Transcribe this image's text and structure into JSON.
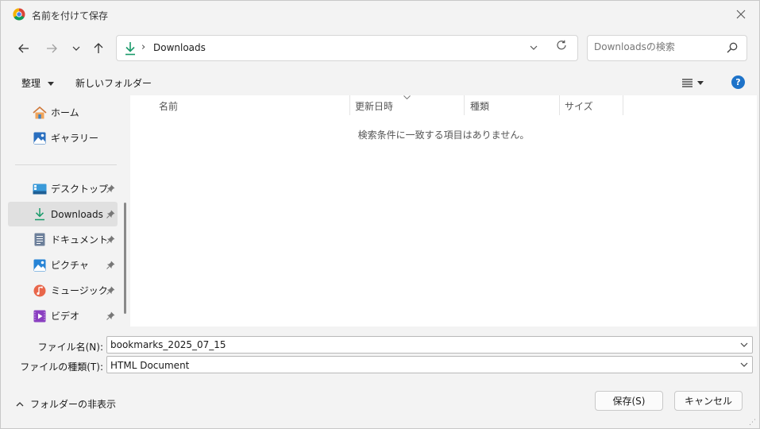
{
  "window": {
    "title": "名前を付けて保存"
  },
  "address": {
    "path_label": "Downloads"
  },
  "search": {
    "placeholder": "Downloadsの検索"
  },
  "commands": {
    "organize": "整理",
    "new_folder": "新しいフォルダー"
  },
  "sidebar": {
    "items": [
      {
        "label": "ホーム",
        "icon": "home-icon"
      },
      {
        "label": "ギャラリー",
        "icon": "gallery-icon"
      },
      {
        "label": "デスクトップ",
        "icon": "desktop-icon",
        "pinned": true
      },
      {
        "label": "Downloads",
        "icon": "download-icon",
        "pinned": true,
        "selected": true
      },
      {
        "label": "ドキュメント",
        "icon": "document-icon",
        "pinned": true
      },
      {
        "label": "ピクチャ",
        "icon": "pictures-icon",
        "pinned": true
      },
      {
        "label": "ミュージック",
        "icon": "music-icon",
        "pinned": true
      },
      {
        "label": "ビデオ",
        "icon": "video-icon",
        "pinned": true
      }
    ]
  },
  "columns": {
    "name": "名前",
    "modified": "更新日時",
    "type": "種類",
    "size": "サイズ"
  },
  "content": {
    "empty_message": "検索条件に一致する項目はありません。"
  },
  "fields": {
    "filename_label": "ファイル名(N):",
    "filename_value": "bookmarks_2025_07_15",
    "filetype_label": "ファイルの種類(T):",
    "filetype_value": "HTML Document"
  },
  "footer": {
    "hide_folders": "フォルダーの非表示",
    "save": "保存(S)",
    "cancel": "キャンセル"
  },
  "colors": {
    "accent": "#1e73c9",
    "download_green": "#1a9a6a",
    "selected_bg": "#e0e0e0"
  }
}
